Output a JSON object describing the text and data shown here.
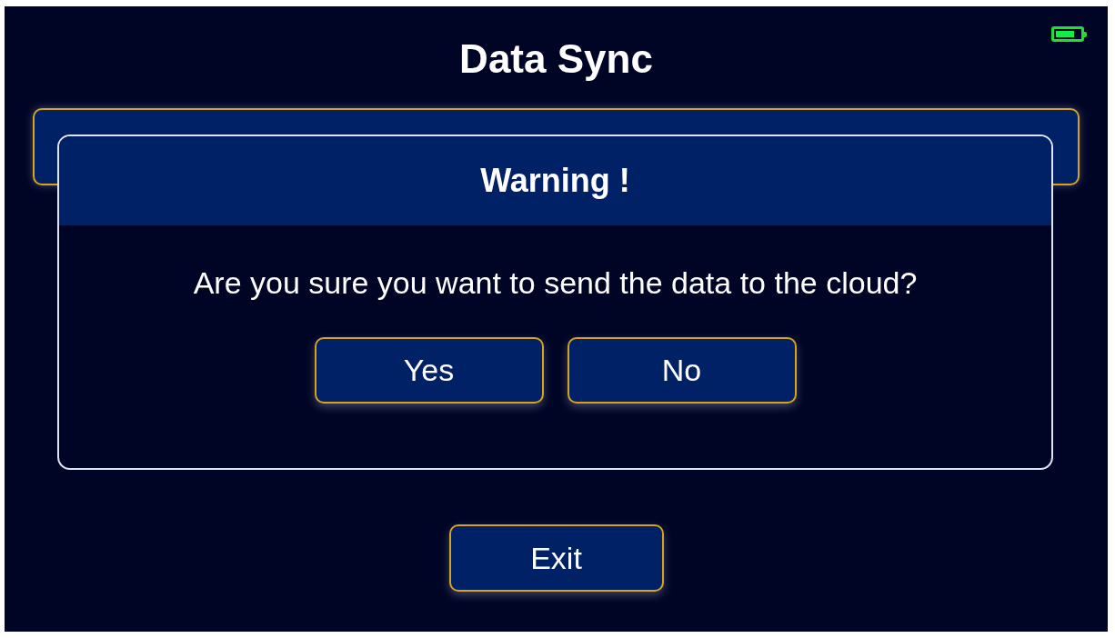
{
  "screen": {
    "title": "Data Sync"
  },
  "dialog": {
    "title": "Warning !",
    "message": "Are you sure you want to send the data to the cloud?",
    "buttons": [
      {
        "label": "Yes"
      },
      {
        "label": "No"
      }
    ]
  },
  "exit_button": {
    "label": "Exit"
  }
}
